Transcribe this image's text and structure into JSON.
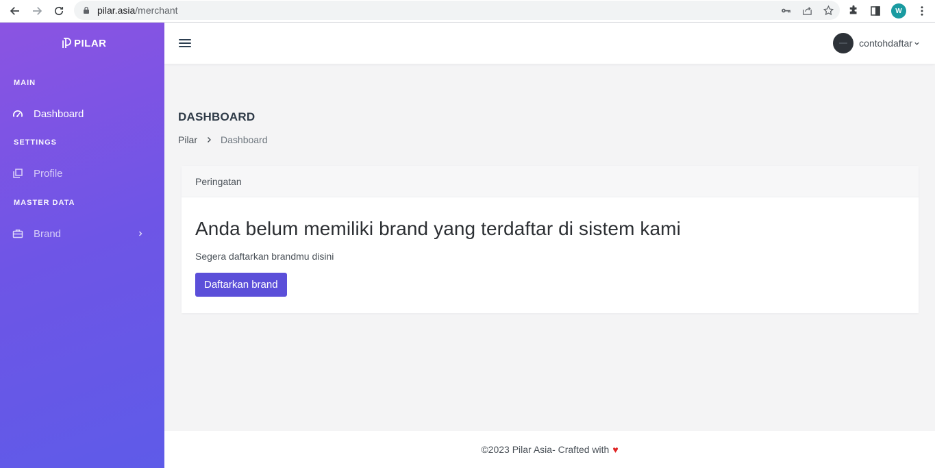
{
  "browser": {
    "url_host": "pilar.asia",
    "url_path": "/merchant",
    "profile_initial": "W"
  },
  "sidebar": {
    "logo_text": "PILAR",
    "sections": [
      {
        "title": "MAIN"
      },
      {
        "title": "SETTINGS"
      },
      {
        "title": "MASTER DATA"
      }
    ],
    "items": [
      {
        "label": "Dashboard",
        "icon": "speedometer-icon"
      },
      {
        "label": "Profile",
        "icon": "copy-icon"
      },
      {
        "label": "Brand",
        "icon": "briefcase-icon"
      }
    ]
  },
  "topbar": {
    "username": "contohdaftar"
  },
  "page": {
    "title": "DASHBOARD",
    "breadcrumb": [
      "Pilar",
      "Dashboard"
    ]
  },
  "card": {
    "header": "Peringatan",
    "heading": "Anda belum memiliki brand yang terdaftar di sistem kami",
    "text": "Segera daftarkan brandmu disini",
    "button_label": "Daftarkan brand"
  },
  "footer": {
    "text": "©2023 Pilar Asia- Crafted with",
    "heart": "♥"
  },
  "colors": {
    "sidebar_start": "#8b54e2",
    "sidebar_end": "#5e5be8",
    "primary_button": "#5b4fd9",
    "heart": "#e02424"
  }
}
